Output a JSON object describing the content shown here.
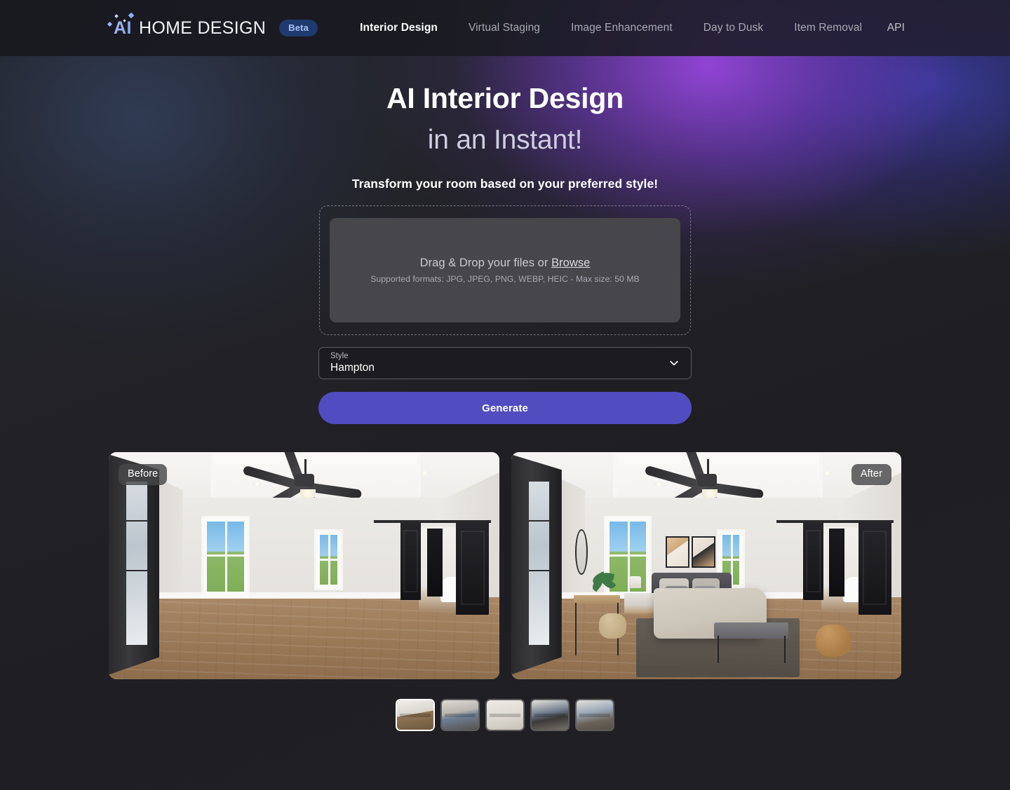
{
  "brand": {
    "ai": "AI",
    "name": "HOME DESIGN",
    "badge": "Beta"
  },
  "nav": {
    "items": [
      {
        "label": "Interior Design",
        "active": true
      },
      {
        "label": "Virtual Staging",
        "active": false
      },
      {
        "label": "Image Enhancement",
        "active": false
      },
      {
        "label": "Day to Dusk",
        "active": false
      },
      {
        "label": "Item Removal",
        "active": false
      }
    ],
    "right_label": "API"
  },
  "hero": {
    "title_line1": "AI Interior Design",
    "title_line2": "in an Instant!",
    "subtitle": "Transform your room based on your preferred style!"
  },
  "uploader": {
    "main_prefix": "Drag & Drop your files or ",
    "browse_label": "Browse",
    "formats": "Supported formats: JPG, JPEG, PNG, WEBP, HEIC - Max size: 50 MB"
  },
  "style_select": {
    "label": "Style",
    "value": "Hampton",
    "chevron_icon": "chevron-down-icon"
  },
  "actions": {
    "generate_label": "Generate",
    "generate_color": "#514CC0"
  },
  "comparison": {
    "before_label": "Before",
    "after_label": "After"
  },
  "thumbnails": {
    "items": [
      {
        "id": "thumb-1",
        "selected": true
      },
      {
        "id": "thumb-2",
        "selected": false
      },
      {
        "id": "thumb-3",
        "selected": false
      },
      {
        "id": "thumb-4",
        "selected": false
      },
      {
        "id": "thumb-5",
        "selected": false
      }
    ]
  }
}
